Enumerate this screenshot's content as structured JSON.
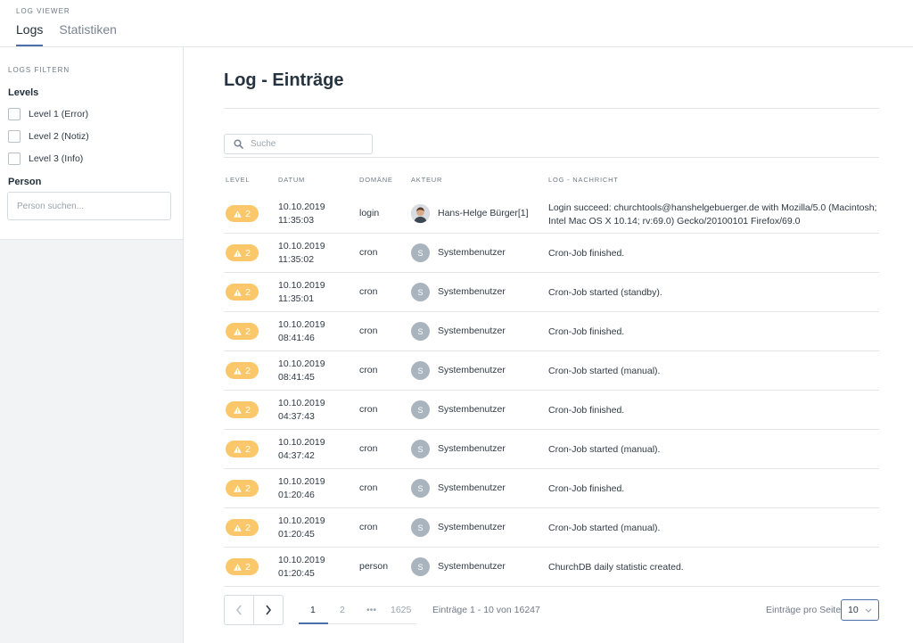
{
  "header": {
    "app_title": "LOG VIEWER",
    "tabs": [
      {
        "label": "Logs",
        "active": true
      },
      {
        "label": "Statistiken",
        "active": false
      }
    ]
  },
  "sidebar": {
    "filter_title": "LOGS FILTERN",
    "levels_label": "Levels",
    "levels": [
      {
        "label": "Level 1 (Error)",
        "checked": false
      },
      {
        "label": "Level 2 (Notiz)",
        "checked": false
      },
      {
        "label": "Level 3 (Info)",
        "checked": false
      }
    ],
    "person_label": "Person",
    "person_placeholder": "Person suchen..."
  },
  "main": {
    "title": "Log - Einträge",
    "search_placeholder": "Suche",
    "columns": [
      "LEVEL",
      "DATUM",
      "DOMÄNE",
      "AKTEUR",
      "LOG - NACHRICHT"
    ],
    "rows": [
      {
        "level": "2",
        "date": "10.10.2019",
        "time": "11:35:03",
        "domain": "login",
        "actor": "Hans-Helge Bürger[1]",
        "avatar": "",
        "avatar_type": "photo",
        "message": "Login succeed: churchtools@hanshelgebuerger.de with Mozilla/5.0 (Macintosh; Intel Mac OS X 10.14; rv:69.0) Gecko/20100101 Firefox/69.0"
      },
      {
        "level": "2",
        "date": "10.10.2019",
        "time": "11:35:02",
        "domain": "cron",
        "actor": "Systembenutzer",
        "avatar": "S",
        "avatar_type": "initial",
        "message": "Cron-Job finished."
      },
      {
        "level": "2",
        "date": "10.10.2019",
        "time": "11:35:01",
        "domain": "cron",
        "actor": "Systembenutzer",
        "avatar": "S",
        "avatar_type": "initial",
        "message": "Cron-Job started (standby)."
      },
      {
        "level": "2",
        "date": "10.10.2019",
        "time": "08:41:46",
        "domain": "cron",
        "actor": "Systembenutzer",
        "avatar": "S",
        "avatar_type": "initial",
        "message": "Cron-Job finished."
      },
      {
        "level": "2",
        "date": "10.10.2019",
        "time": "08:41:45",
        "domain": "cron",
        "actor": "Systembenutzer",
        "avatar": "S",
        "avatar_type": "initial",
        "message": "Cron-Job started (manual)."
      },
      {
        "level": "2",
        "date": "10.10.2019",
        "time": "04:37:43",
        "domain": "cron",
        "actor": "Systembenutzer",
        "avatar": "S",
        "avatar_type": "initial",
        "message": "Cron-Job finished."
      },
      {
        "level": "2",
        "date": "10.10.2019",
        "time": "04:37:42",
        "domain": "cron",
        "actor": "Systembenutzer",
        "avatar": "S",
        "avatar_type": "initial",
        "message": "Cron-Job started (manual)."
      },
      {
        "level": "2",
        "date": "10.10.2019",
        "time": "01:20:46",
        "domain": "cron",
        "actor": "Systembenutzer",
        "avatar": "S",
        "avatar_type": "initial",
        "message": "Cron-Job finished."
      },
      {
        "level": "2",
        "date": "10.10.2019",
        "time": "01:20:45",
        "domain": "cron",
        "actor": "Systembenutzer",
        "avatar": "S",
        "avatar_type": "initial",
        "message": "Cron-Job started (manual)."
      },
      {
        "level": "2",
        "date": "10.10.2019",
        "time": "01:20:45",
        "domain": "person",
        "actor": "Systembenutzer",
        "avatar": "S",
        "avatar_type": "initial",
        "message": "ChurchDB daily statistic created."
      }
    ]
  },
  "pagination": {
    "pages": [
      "1",
      "2",
      "•••",
      "1625"
    ],
    "current_page": "1",
    "entries_info": "Einträge 1 - 10 von 16247",
    "per_page_label": "Einträge pro Seite",
    "per_page_value": "10"
  },
  "colors": {
    "accent": "#4c6fa8",
    "warning_badge": "#fac76b",
    "avatar_gray": "#a9b4bf"
  },
  "icons": {
    "search": "search-icon",
    "warning": "warning-icon",
    "prev": "chevron-left-icon",
    "next": "chevron-right-icon",
    "select": "chevron-down-icon"
  }
}
